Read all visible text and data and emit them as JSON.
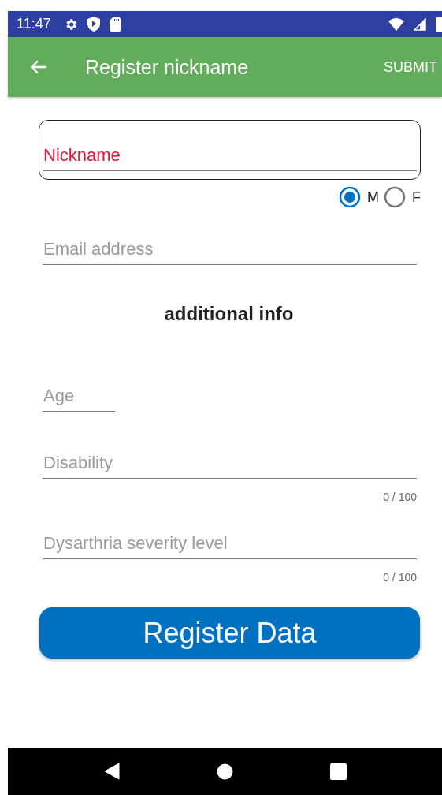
{
  "status_bar": {
    "time": "11:47"
  },
  "app_bar": {
    "title": "Register nickname",
    "action": "SUBMIT"
  },
  "nickname": {
    "placeholder": "Nickname"
  },
  "gender": [
    {
      "label": "M",
      "selected": true
    },
    {
      "label": "F",
      "selected": false
    }
  ],
  "email": {
    "placeholder": "Email address"
  },
  "section_title": "additional info",
  "fields": [
    {
      "kind": "short",
      "placeholder": "Age"
    },
    {
      "kind": "counted",
      "placeholder": "Disability",
      "counter": "0 / 100"
    },
    {
      "kind": "counted",
      "placeholder": "Dysarthria severity level",
      "counter": "0 / 100"
    }
  ],
  "submit_button": "Register Data"
}
